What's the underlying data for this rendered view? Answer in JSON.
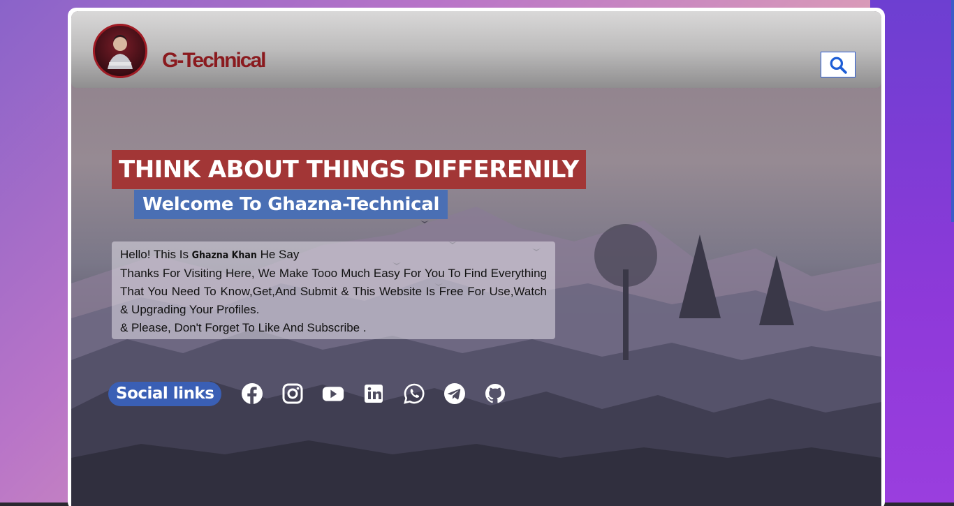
{
  "header": {
    "brand": "G-Technical",
    "avatar_icon": "profile-photo",
    "search_icon": "search-icon"
  },
  "hero": {
    "headline": "THINK ABOUT THINGS DIFFERENILY",
    "subheadline": "Welcome To Ghazna-Technical"
  },
  "intro": {
    "greeting_prefix": "Hello! This Is ",
    "name": "Ghazna Khan",
    "greeting_suffix": " He Say",
    "body": "Thanks For Visiting Here, We Make Tooo Much Easy For You To Find Everything That You Need To Know,Get,And Submit & This Website Is Free For Use,Watch & Upgrading Your Profiles.",
    "closing": "& Please, Don't Forget To Like And Subscribe ."
  },
  "social": {
    "label": "Social links",
    "icons": [
      "facebook-icon",
      "instagram-icon",
      "youtube-icon",
      "linkedin-icon",
      "whatsapp-icon",
      "telegram-icon",
      "github-icon"
    ]
  },
  "colors": {
    "headline_bg": "#a23636",
    "subheadline_bg": "#4a6fb4",
    "brand": "#8a1a1e",
    "search_accent": "#2a5bd7",
    "social_label_bg": "#3a5fb5"
  }
}
